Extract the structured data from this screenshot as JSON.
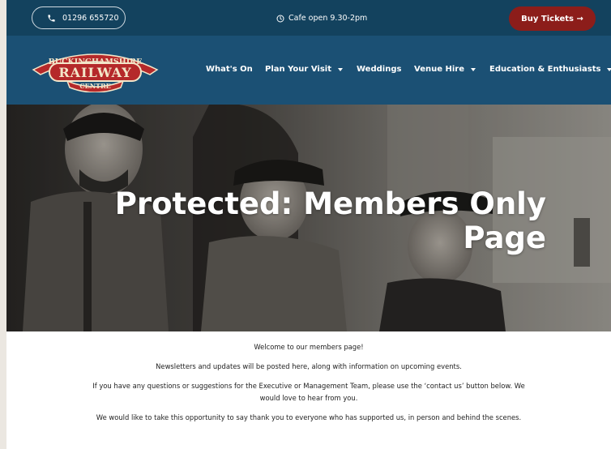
{
  "topbar": {
    "phone": "01296 655720",
    "phone_icon": "phone-icon",
    "cafe": "Cafe open 9.30-2pm",
    "cafe_icon": "clock-icon",
    "buy_tickets": "Buy Tickets →"
  },
  "logo": {
    "line1": "BUCKINGHAMSHIRE",
    "line2": "RAILWAY",
    "line3": "CENTRE"
  },
  "nav": {
    "items": [
      {
        "label": "What's On",
        "dropdown": false
      },
      {
        "label": "Plan Your Visit",
        "dropdown": true
      },
      {
        "label": "Weddings",
        "dropdown": false
      },
      {
        "label": "Venue Hire",
        "dropdown": true
      },
      {
        "label": "Education & Enthusiasts",
        "dropdown": true
      }
    ]
  },
  "hero": {
    "title_line1": "Protected: Members Only",
    "title_line2": "Page"
  },
  "content": {
    "p1": "Welcome to our members page!",
    "p2": "Newsletters and updates will be posted here, along with information on upcoming events.",
    "p3a": "If you have any questions or suggestions for the Executive or Management Team, please use the ‘contact us’ button below. We",
    "p3b": "would love to hear from you.",
    "p4": "We would like to take this opportunity to say thank you to everyone who has supported us, in person and behind the scenes."
  },
  "colors": {
    "topbar": "#13425e",
    "navbar": "#1b5074",
    "buy_button": "#8c1d1a",
    "logo_red": "#b5292a",
    "logo_cream": "#f3e6c9"
  }
}
